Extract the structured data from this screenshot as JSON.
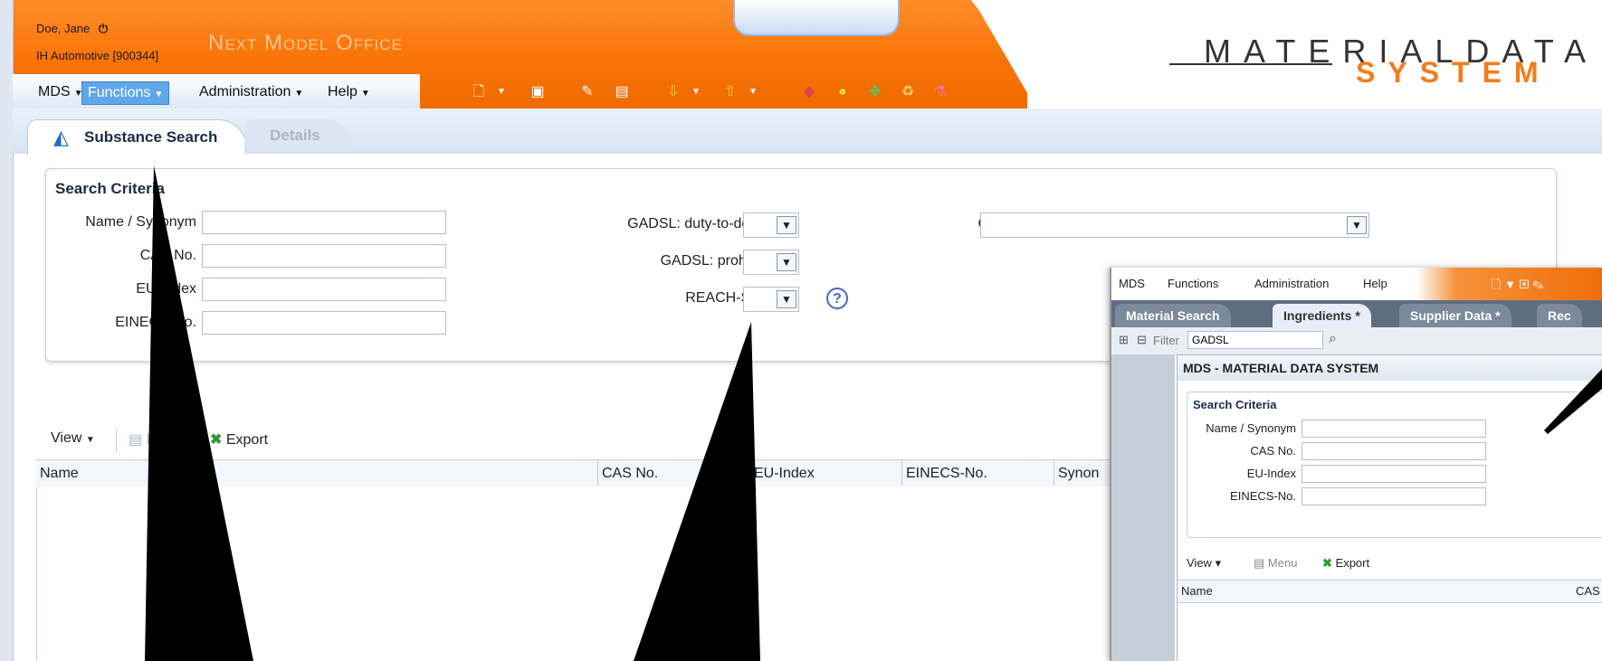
{
  "header": {
    "user_name": "Doe, Jane",
    "company": "IH Automotive [900344]",
    "office_name": "Next Model Office",
    "brand_top": "MATERIALDATA",
    "brand_bottom": "SYSTEM"
  },
  "menu": {
    "items": [
      {
        "label": "MDS"
      },
      {
        "label": "Functions"
      },
      {
        "label": "Administration"
      },
      {
        "label": "Help"
      }
    ]
  },
  "tabs": {
    "active": "Substance Search",
    "inactive": "Details"
  },
  "search": {
    "panel_title": "Search Criteria",
    "name_label": "Name / Synonym",
    "cas_label": "CAS No.",
    "eu_label": "EU-Index",
    "einecs_label": "EINECS-No.",
    "gadsl_declare_label": "GADSL: duty-to-declare",
    "gadsl_prohibited_label": "GADSL: prohibited",
    "reach_label": "REACH-SVHC",
    "group_label": "Group",
    "help_glyph": "?"
  },
  "results": {
    "view_label": "View",
    "menu_label": "Menu",
    "export_label": "Export",
    "columns": [
      "Name",
      "CAS No.",
      "EU-Index",
      "EINECS-No.",
      "Synon"
    ]
  },
  "inset": {
    "menu": [
      "MDS",
      "Functions",
      "Administration",
      "Help"
    ],
    "tabs": [
      "Material Search",
      "Ingredients *",
      "Supplier Data *",
      "Rec"
    ],
    "filter_label": "Filter",
    "filter_value": "GADSL",
    "dialog_title": "MDS - MATERIAL DATA SYSTEM",
    "panel_title": "Search Criteria",
    "name_label": "Name / Synonym",
    "cas_label": "CAS No.",
    "eu_label": "EU-Index",
    "einecs_label": "EINECS-No.",
    "view_label": "View",
    "menu_label": "Menu",
    "export_label": "Export",
    "col_name": "Name",
    "col_cas": "CAS"
  },
  "colors": {
    "accent_orange": "#f97406",
    "menu_active": "#5fa7e8",
    "brand_orange": "#f57c1a"
  }
}
